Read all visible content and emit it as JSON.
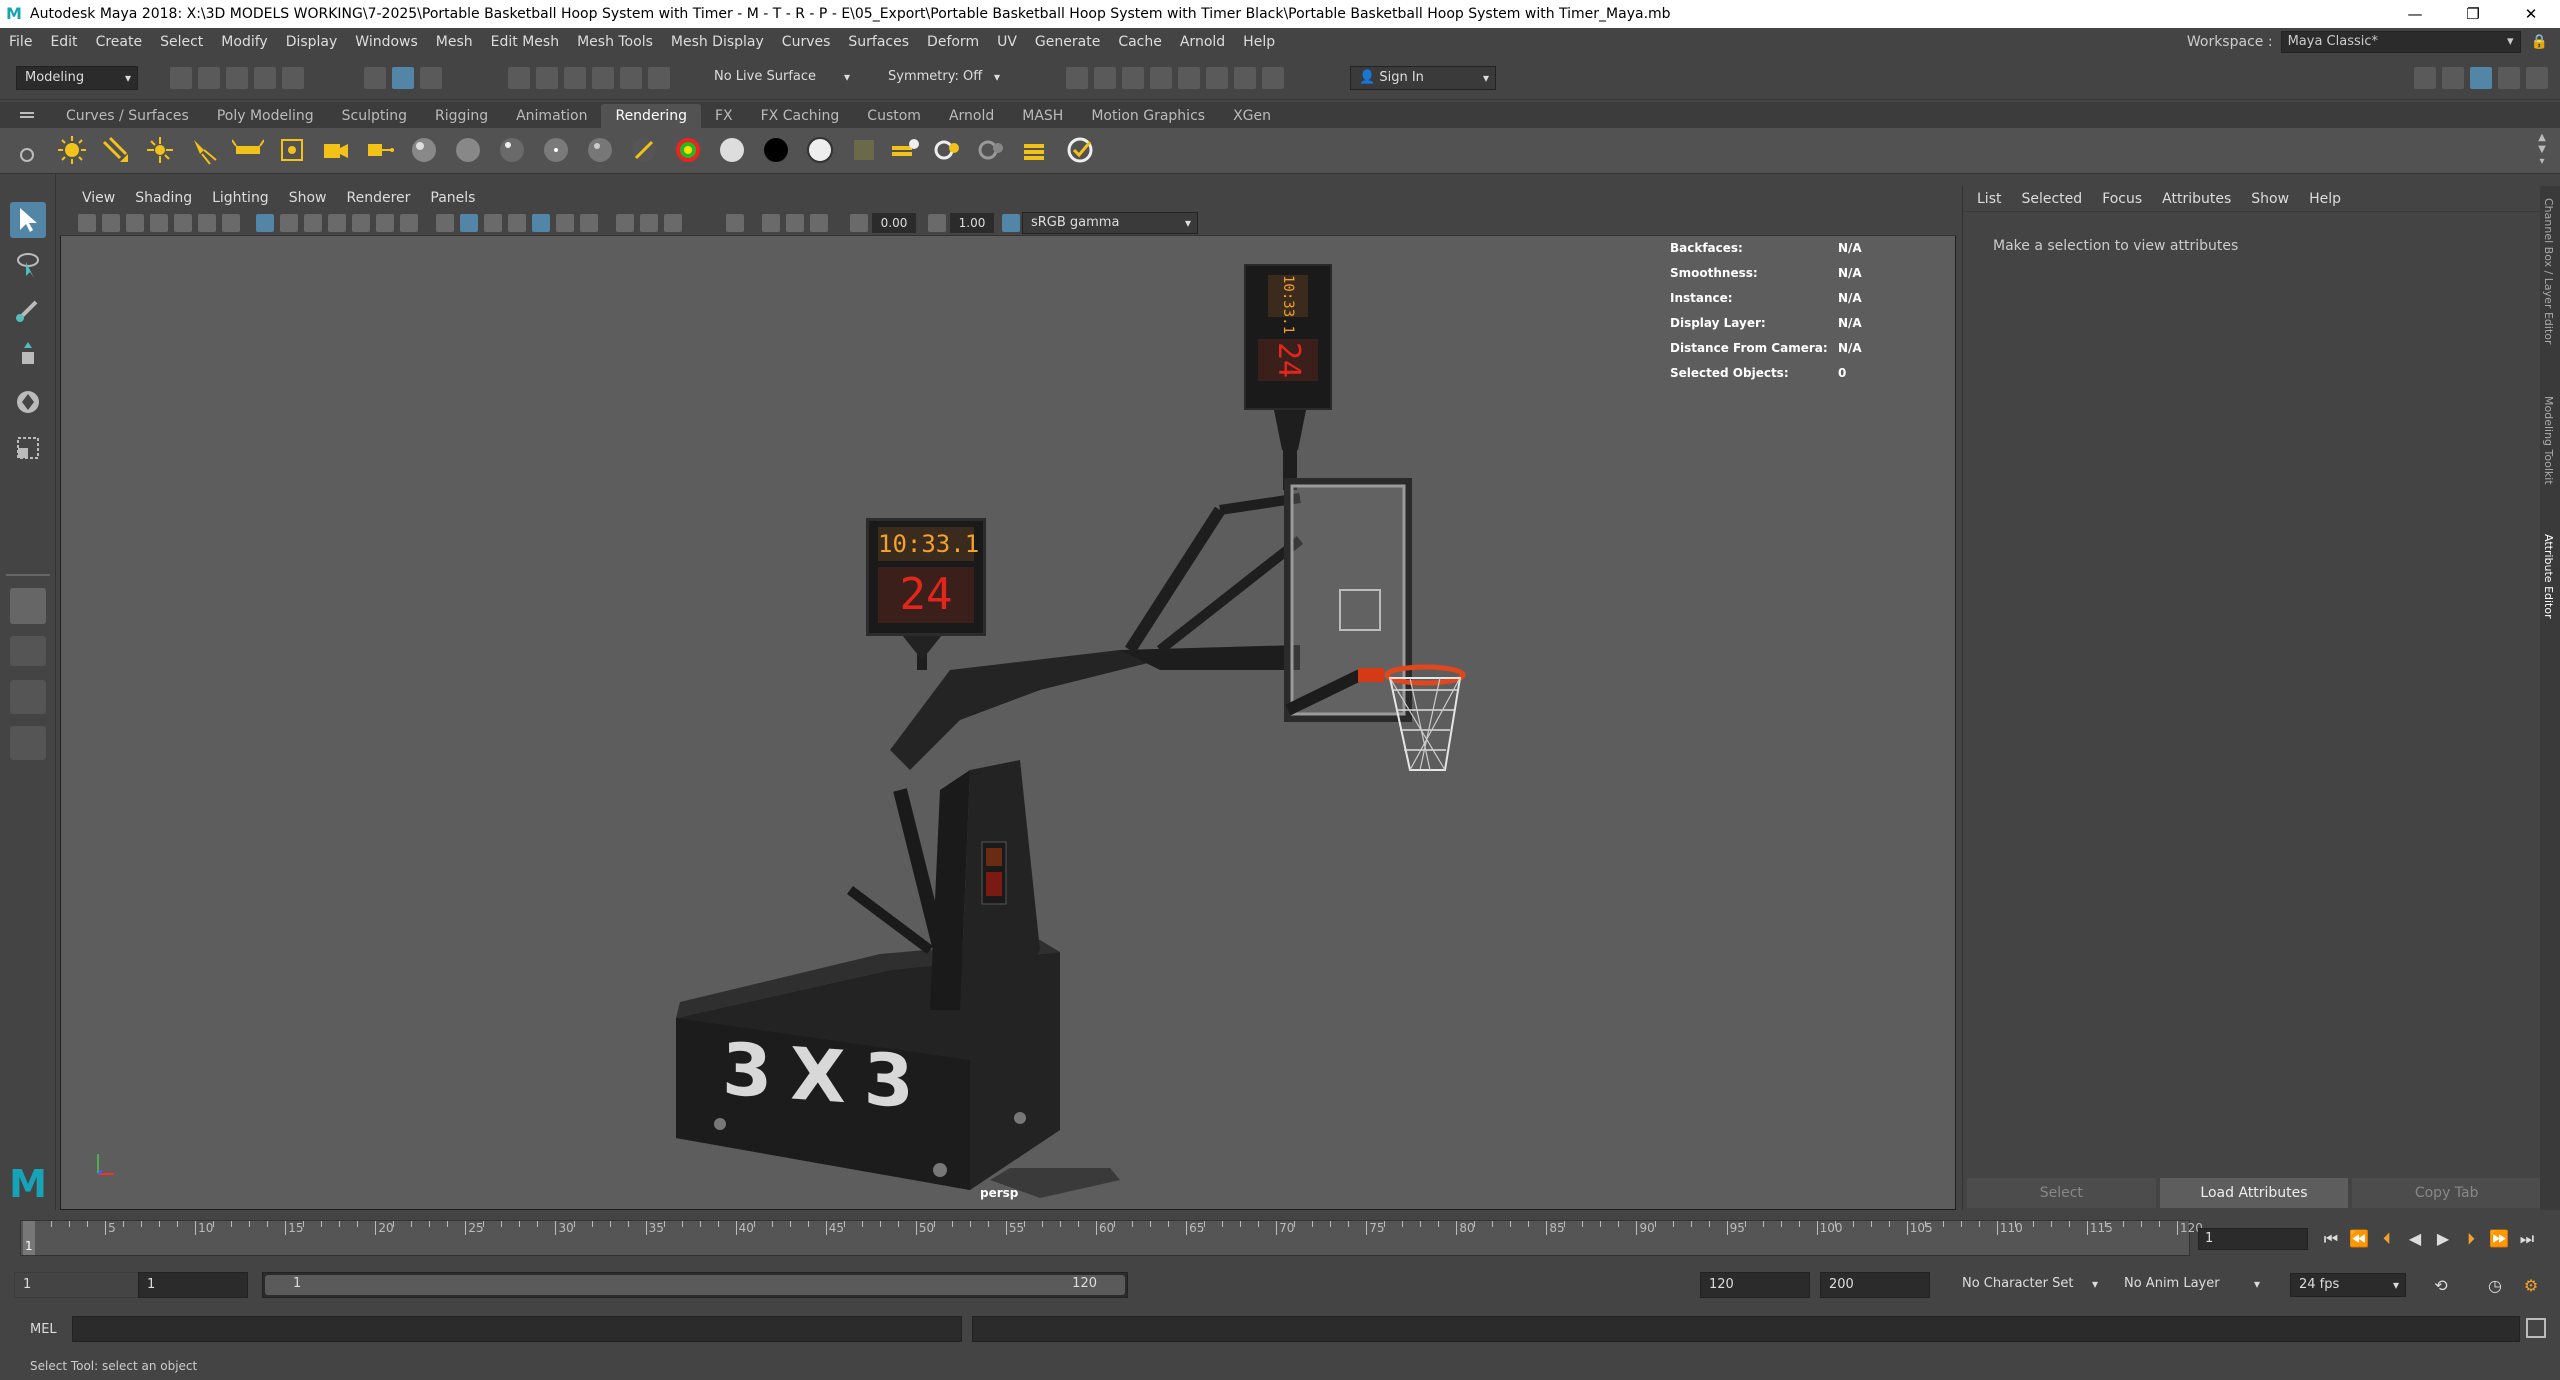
{
  "window": {
    "title": "Autodesk Maya 2018: X:\\3D MODELS WORKING\\7-2025\\Portable Basketball Hoop System with Timer - M - T - R - P - E\\05_Export\\Portable Basketball Hoop System with Timer Black\\Portable Basketball Hoop System with Timer_Maya.mb"
  },
  "menus": [
    "File",
    "Edit",
    "Create",
    "Select",
    "Modify",
    "Display",
    "Windows",
    "Mesh",
    "Edit Mesh",
    "Mesh Tools",
    "Mesh Display",
    "Curves",
    "Surfaces",
    "Deform",
    "UV",
    "Generate",
    "Cache",
    "Arnold",
    "Help"
  ],
  "workspace": {
    "label": "Workspace :",
    "value": "Maya Classic*"
  },
  "status": {
    "mode": "Modeling",
    "live_surface": "No Live Surface",
    "symmetry": "Symmetry: Off",
    "sign_in": "Sign In"
  },
  "shelf_tabs": [
    "Curves / Surfaces",
    "Poly Modeling",
    "Sculpting",
    "Rigging",
    "Animation",
    "Rendering",
    "FX",
    "FX Caching",
    "Custom",
    "Arnold",
    "MASH",
    "Motion Graphics",
    "XGen"
  ],
  "shelf_active": "Rendering",
  "viewport": {
    "menus": [
      "View",
      "Shading",
      "Lighting",
      "Show",
      "Renderer",
      "Panels"
    ],
    "exposure": "0.00",
    "gamma": "1.00",
    "color_space": "sRGB gamma",
    "camera": "persp",
    "hud": [
      {
        "k": "Backfaces:",
        "v": "N/A"
      },
      {
        "k": "Smoothness:",
        "v": "N/A"
      },
      {
        "k": "Instance:",
        "v": "N/A"
      },
      {
        "k": "Display Layer:",
        "v": "N/A"
      },
      {
        "k": "Distance From Camera:",
        "v": "N/A"
      },
      {
        "k": "Selected Objects:",
        "v": "0"
      }
    ],
    "model": {
      "board_time": "10:33.1",
      "board_shot": "24",
      "base_text": "3X3"
    }
  },
  "attr_editor": {
    "menus": [
      "List",
      "Selected",
      "Focus",
      "Attributes",
      "Show",
      "Help"
    ],
    "message": "Make a selection to view attributes",
    "buttons": [
      "Select",
      "Load Attributes",
      "Copy Tab"
    ]
  },
  "side_tabs": [
    "Channel Box / Layer Editor",
    "Modeling Toolkit",
    "Attribute Editor"
  ],
  "timeline": {
    "ticks": [
      5,
      10,
      15,
      20,
      25,
      30,
      35,
      40,
      45,
      50,
      55,
      60,
      65,
      70,
      75,
      80,
      85,
      90,
      95,
      100,
      105,
      110,
      115,
      120
    ],
    "start": 1,
    "end": 120,
    "current_frame": "1"
  },
  "range": {
    "start": "1",
    "inner_start": "1",
    "slider_start": "1",
    "slider_end": "120",
    "end": "120",
    "anim_end": "200",
    "character_set": "No Character Set",
    "anim_layer": "No Anim Layer",
    "fps": "24 fps"
  },
  "command": {
    "lang": "MEL"
  },
  "help_line": "Select Tool: select an object"
}
